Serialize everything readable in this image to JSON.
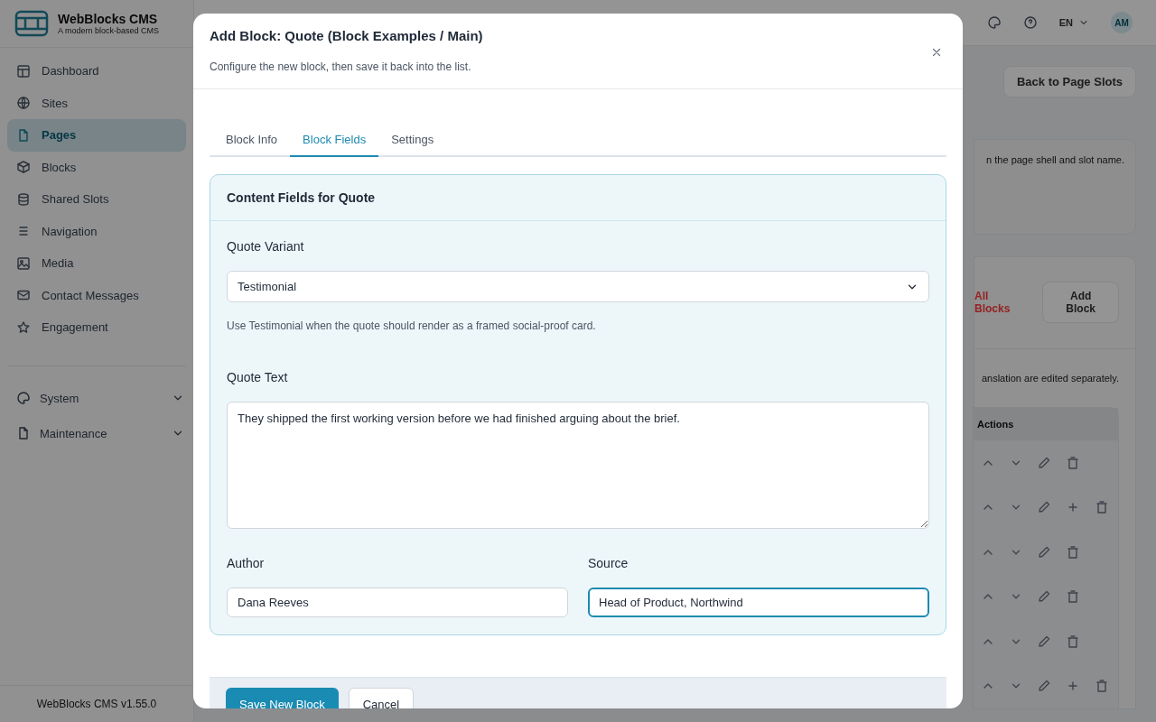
{
  "app": {
    "name": "WebBlocks CMS",
    "tagline": "A modern block-based CMS",
    "version": "WebBlocks CMS v1.55.0"
  },
  "sidebar": {
    "items": [
      {
        "label": "Dashboard",
        "selected": false
      },
      {
        "label": "Sites",
        "selected": false
      },
      {
        "label": "Pages",
        "selected": true
      },
      {
        "label": "Blocks",
        "selected": false
      },
      {
        "label": "Shared Slots",
        "selected": false
      },
      {
        "label": "Navigation",
        "selected": false
      },
      {
        "label": "Media",
        "selected": false
      },
      {
        "label": "Contact Messages",
        "selected": false
      },
      {
        "label": "Engagement",
        "selected": false
      }
    ],
    "groups": [
      {
        "label": "System",
        "expanded": false
      },
      {
        "label": "Maintenance",
        "expanded": false
      }
    ]
  },
  "topbar": {
    "language": "EN",
    "avatar": "AM"
  },
  "page": {
    "back_button": "Back to Page Slots",
    "intro_text": "n the page shell and slot name.",
    "delete_link": "All Blocks",
    "add_button": "Add Block",
    "note": "anslation are edited separately.",
    "actions_header": "Actions",
    "action_rows": [
      {
        "addable": false
      },
      {
        "addable": true
      },
      {
        "addable": false
      },
      {
        "addable": false
      },
      {
        "addable": false
      },
      {
        "addable": true
      }
    ]
  },
  "modal": {
    "title": "Add Block: Quote (Block Examples / Main)",
    "subtitle": "Configure the new block, then save it back into the list.",
    "tabs": [
      {
        "label": "Block Info",
        "selected": false
      },
      {
        "label": "Block Fields",
        "selected": true
      },
      {
        "label": "Settings",
        "selected": false
      }
    ],
    "panel_title": "Content Fields for Quote",
    "fields": [
      {
        "kind": "select",
        "label": "Quote Variant",
        "value": "Testimonial",
        "help": "Use Testimonial when the quote should render as a framed social-proof card."
      },
      {
        "kind": "textarea",
        "label": "Quote Text",
        "value": "They shipped the first working version before we had finished arguing about the brief."
      }
    ],
    "pair": [
      {
        "label": "Author",
        "value": "Dana Reeves",
        "focused": false
      },
      {
        "label": "Source",
        "value": "Head of Product, Northwind",
        "focused": true
      }
    ],
    "save_button": "Save New Block",
    "cancel_button": "Cancel"
  }
}
